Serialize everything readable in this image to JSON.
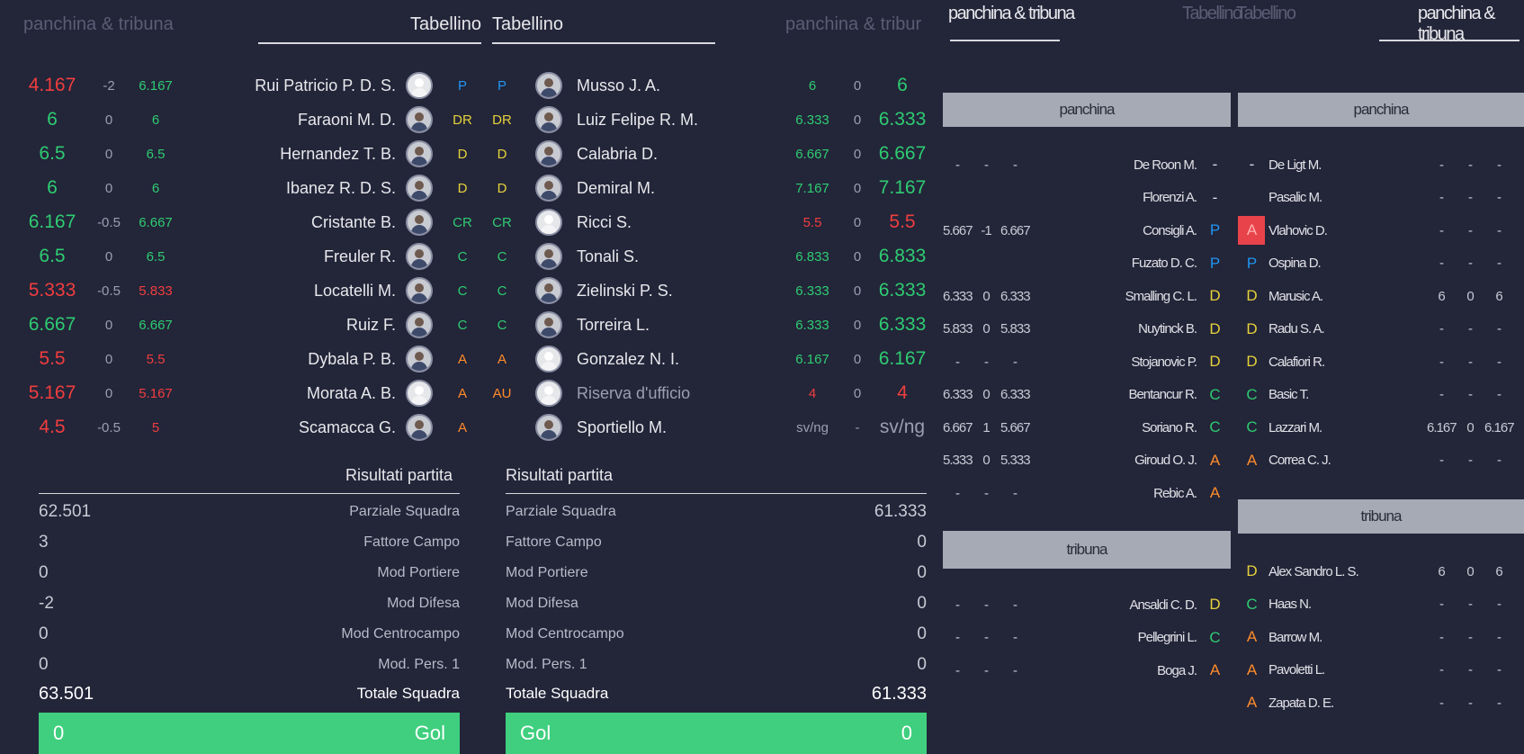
{
  "left": {
    "header_bench": "panchina & tribuna",
    "header_tab_home": "Tabellino",
    "header_tab_away": "Tabellino",
    "header_bench_away": "panchina & tribur",
    "home_players": [
      {
        "total": "4.167",
        "mod": "-2",
        "vote": "6.167",
        "color": "red",
        "vcolor": "green",
        "name": "Rui Patricio P. D. S.",
        "role": "P",
        "blank": true
      },
      {
        "total": "6",
        "mod": "0",
        "vote": "6",
        "color": "green",
        "vcolor": "green",
        "name": "Faraoni M. D.",
        "role": "DR",
        "blank": false
      },
      {
        "total": "6.5",
        "mod": "0",
        "vote": "6.5",
        "color": "green",
        "vcolor": "green",
        "name": "Hernandez T. B.",
        "role": "D",
        "blank": false
      },
      {
        "total": "6",
        "mod": "0",
        "vote": "6",
        "color": "green",
        "vcolor": "green",
        "name": "Ibanez R. D. S.",
        "role": "D",
        "blank": false
      },
      {
        "total": "6.167",
        "mod": "-0.5",
        "vote": "6.667",
        "color": "green",
        "vcolor": "green",
        "name": "Cristante B.",
        "role": "CR",
        "blank": false
      },
      {
        "total": "6.5",
        "mod": "0",
        "vote": "6.5",
        "color": "green",
        "vcolor": "green",
        "name": "Freuler R.",
        "role": "C",
        "blank": false
      },
      {
        "total": "5.333",
        "mod": "-0.5",
        "vote": "5.833",
        "color": "red",
        "vcolor": "red",
        "name": "Locatelli M.",
        "role": "C",
        "blank": false
      },
      {
        "total": "6.667",
        "mod": "0",
        "vote": "6.667",
        "color": "green",
        "vcolor": "green",
        "name": "Ruiz F.",
        "role": "C",
        "blank": false
      },
      {
        "total": "5.5",
        "mod": "0",
        "vote": "5.5",
        "color": "red",
        "vcolor": "red",
        "name": "Dybala P. B.",
        "role": "A",
        "blank": false
      },
      {
        "total": "5.167",
        "mod": "0",
        "vote": "5.167",
        "color": "red",
        "vcolor": "red",
        "name": "Morata A. B.",
        "role": "A",
        "blank": true
      },
      {
        "total": "4.5",
        "mod": "-0.5",
        "vote": "5",
        "color": "red",
        "vcolor": "red",
        "name": "Scamacca G.",
        "role": "A",
        "blank": false
      }
    ],
    "away_players": [
      {
        "role": "P",
        "name": "Musso J. A.",
        "vote": "6",
        "mod": "0",
        "total": "6",
        "color": "green",
        "blank": false,
        "dim": false
      },
      {
        "role": "DR",
        "name": "Luiz Felipe R. M.",
        "vote": "6.333",
        "mod": "0",
        "total": "6.333",
        "color": "green",
        "blank": false,
        "dim": false
      },
      {
        "role": "D",
        "name": "Calabria D.",
        "vote": "6.667",
        "mod": "0",
        "total": "6.667",
        "color": "green",
        "blank": false,
        "dim": false
      },
      {
        "role": "D",
        "name": "Demiral M.",
        "vote": "7.167",
        "mod": "0",
        "total": "7.167",
        "color": "green",
        "blank": false,
        "dim": false
      },
      {
        "role": "CR",
        "name": "Ricci S.",
        "vote": "5.5",
        "mod": "0",
        "total": "5.5",
        "color": "red",
        "blank": true,
        "dim": false
      },
      {
        "role": "C",
        "name": "Tonali S.",
        "vote": "6.833",
        "mod": "0",
        "total": "6.833",
        "color": "green",
        "blank": false,
        "dim": false
      },
      {
        "role": "C",
        "name": "Zielinski P. S.",
        "vote": "6.333",
        "mod": "0",
        "total": "6.333",
        "color": "green",
        "blank": false,
        "dim": false
      },
      {
        "role": "C",
        "name": "Torreira L.",
        "vote": "6.333",
        "mod": "0",
        "total": "6.333",
        "color": "green",
        "blank": false,
        "dim": false
      },
      {
        "role": "A",
        "name": "Gonzalez N. I.",
        "vote": "6.167",
        "mod": "0",
        "total": "6.167",
        "color": "green",
        "blank": true,
        "dim": false
      },
      {
        "role": "AU",
        "name": "Riserva d'ufficio",
        "vote": "4",
        "mod": "0",
        "total": "4",
        "color": "red",
        "blank": true,
        "dim": true
      },
      {
        "role": "",
        "name": "Sportiello M.",
        "vote": "sv/ng",
        "mod": "-",
        "total": "sv/ng",
        "color": "gray",
        "blank": false,
        "dim": false
      }
    ],
    "results_title": "Risultati partita",
    "results": [
      {
        "label": "Parziale Squadra",
        "home": "62.501",
        "away": "61.333"
      },
      {
        "label": "Fattore Campo",
        "home": "3",
        "away": "0"
      },
      {
        "label": "Mod Portiere",
        "home": "0",
        "away": "0"
      },
      {
        "label": "Mod Difesa",
        "home": "-2",
        "away": "0"
      },
      {
        "label": "Mod Centrocampo",
        "home": "0",
        "away": "0"
      },
      {
        "label": "Mod. Pers. 1",
        "home": "0",
        "away": "0"
      }
    ],
    "total_label": "Totale Squadra",
    "total_home": "63.501",
    "total_away": "61.333",
    "gol_label": "Gol",
    "gol_home": "0",
    "gol_away": "0"
  },
  "right": {
    "tab_bench": "panchina & tribuna",
    "tab_t1": "Tabellino",
    "tab_t2": "Tabellino",
    "tab_bench2": "panchina & tribuna",
    "panchina": "panchina",
    "tribuna": "tribuna",
    "home_bench": [
      {
        "v": "-",
        "m": "-",
        "t": "-",
        "name": "De Roon M.",
        "role": "-"
      },
      {
        "v": "",
        "m": "",
        "t": "",
        "name": "Florenzi A.",
        "role": "-"
      },
      {
        "v": "5.667",
        "m": "-1",
        "t": "6.667",
        "name": "Consigli A.",
        "role": "P"
      },
      {
        "v": "",
        "m": "",
        "t": "",
        "name": "Fuzato D. C.",
        "role": "P"
      },
      {
        "v": "6.333",
        "m": "0",
        "t": "6.333",
        "name": "Smalling C. L.",
        "role": "D"
      },
      {
        "v": "5.833",
        "m": "0",
        "t": "5.833",
        "name": "Nuytinck B.",
        "role": "D"
      },
      {
        "v": "-",
        "m": "-",
        "t": "-",
        "name": "Stojanovic P.",
        "role": "D"
      },
      {
        "v": "6.333",
        "m": "0",
        "t": "6.333",
        "name": "Bentancur R.",
        "role": "C"
      },
      {
        "v": "6.667",
        "m": "1",
        "t": "5.667",
        "name": "Soriano R.",
        "role": "C"
      },
      {
        "v": "5.333",
        "m": "0",
        "t": "5.333",
        "name": "Giroud O. J.",
        "role": "A"
      },
      {
        "v": "-",
        "m": "-",
        "t": "-",
        "name": "Rebic A.",
        "role": "A"
      }
    ],
    "home_tribuna": [
      {
        "v": "-",
        "m": "-",
        "t": "-",
        "name": "Ansaldi C. D.",
        "role": "D"
      },
      {
        "v": "-",
        "m": "-",
        "t": "-",
        "name": "Pellegrini L.",
        "role": "C"
      },
      {
        "v": "-",
        "m": "-",
        "t": "-",
        "name": "Boga J.",
        "role": "A"
      }
    ],
    "away_bench": [
      {
        "role": "-",
        "name": "De Ligt M.",
        "v": "-",
        "m": "-",
        "t": "-",
        "hl": false
      },
      {
        "role": "",
        "name": "Pasalic M.",
        "v": "-",
        "m": "-",
        "t": "-",
        "hl": false
      },
      {
        "role": "A",
        "name": "Vlahovic D.",
        "v": "-",
        "m": "-",
        "t": "-",
        "hl": true
      },
      {
        "role": "P",
        "name": "Ospina D.",
        "v": "-",
        "m": "-",
        "t": "-",
        "hl": false
      },
      {
        "role": "D",
        "name": "Marusic A.",
        "v": "6",
        "m": "0",
        "t": "6",
        "hl": false
      },
      {
        "role": "D",
        "name": "Radu S. A.",
        "v": "-",
        "m": "-",
        "t": "-",
        "hl": false
      },
      {
        "role": "D",
        "name": "Calafiori R.",
        "v": "-",
        "m": "-",
        "t": "-",
        "hl": false
      },
      {
        "role": "C",
        "name": "Basic T.",
        "v": "-",
        "m": "-",
        "t": "-",
        "hl": false
      },
      {
        "role": "C",
        "name": "Lazzari M.",
        "v": "6.167",
        "m": "0",
        "t": "6.167",
        "hl": false
      },
      {
        "role": "A",
        "name": "Correa C. J.",
        "v": "-",
        "m": "-",
        "t": "-",
        "hl": false
      }
    ],
    "away_tribuna": [
      {
        "role": "D",
        "name": "Alex Sandro L. S.",
        "v": "6",
        "m": "0",
        "t": "6"
      },
      {
        "role": "C",
        "name": "Haas N.",
        "v": "-",
        "m": "-",
        "t": "-"
      },
      {
        "role": "A",
        "name": "Barrow M.",
        "v": "-",
        "m": "-",
        "t": "-"
      },
      {
        "role": "A",
        "name": "Pavoletti L.",
        "v": "-",
        "m": "-",
        "t": "-"
      },
      {
        "role": "A",
        "name": "Zapata D. E.",
        "v": "-",
        "m": "-",
        "t": "-"
      }
    ]
  }
}
